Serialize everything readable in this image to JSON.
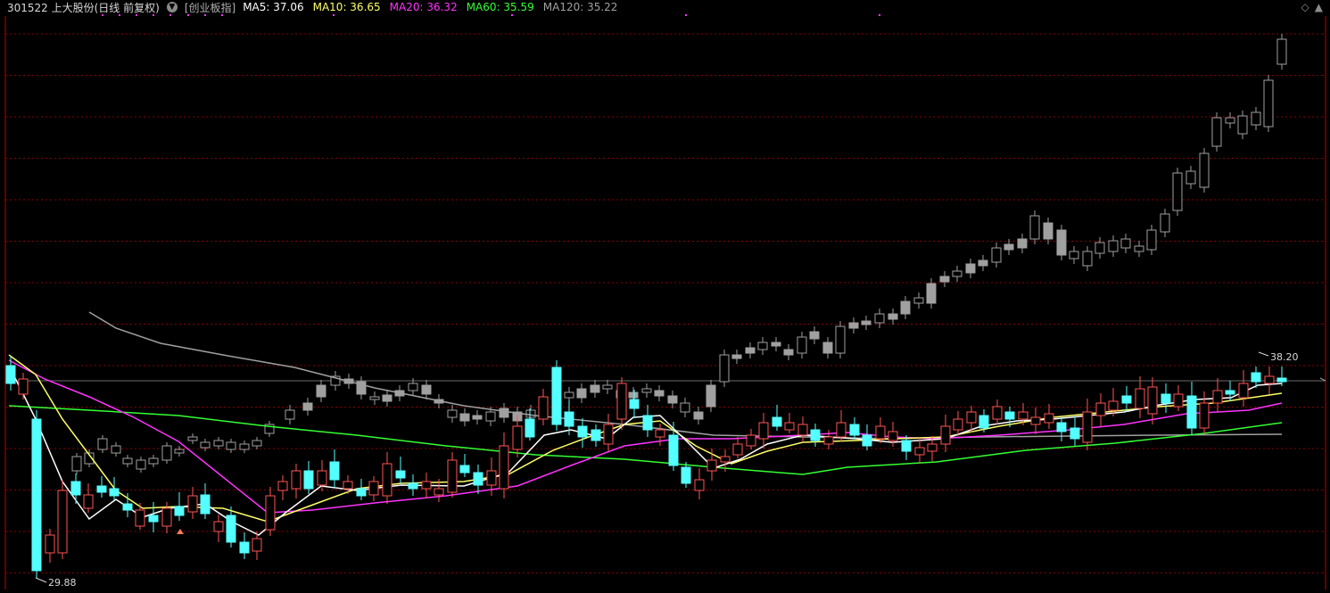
{
  "header": {
    "title": "301522 上大股份(日线 前复权)",
    "index_name": "[创业板指]",
    "ma_labels": [
      {
        "label": "MA5: 37.06",
        "color": "#ffffff"
      },
      {
        "label": "MA10: 36.65",
        "color": "#ffff66"
      },
      {
        "label": "MA20: 36.32",
        "color": "#ff33ff"
      },
      {
        "label": "MA60: 35.59",
        "color": "#33ff33"
      },
      {
        "label": "MA120: 35.22",
        "color": "#a0a0a0"
      }
    ],
    "controls": {
      "up_arrow": "◇",
      "down_arrow": "▲"
    }
  },
  "chart_data": {
    "type": "candlestick",
    "annotations": {
      "high_label": "38.20",
      "low_label": "29.88"
    },
    "colors": {
      "up": "#ff5454",
      "down": "#54ffff",
      "index_candle": "#a0a0a0",
      "ma5": "#ffffff",
      "ma10": "#ffff66",
      "ma20": "#ff33ff",
      "ma60": "#33ff33",
      "ma120": "#a0a0a0",
      "grid": "#8a0000",
      "axis": "#c00000"
    }
  }
}
